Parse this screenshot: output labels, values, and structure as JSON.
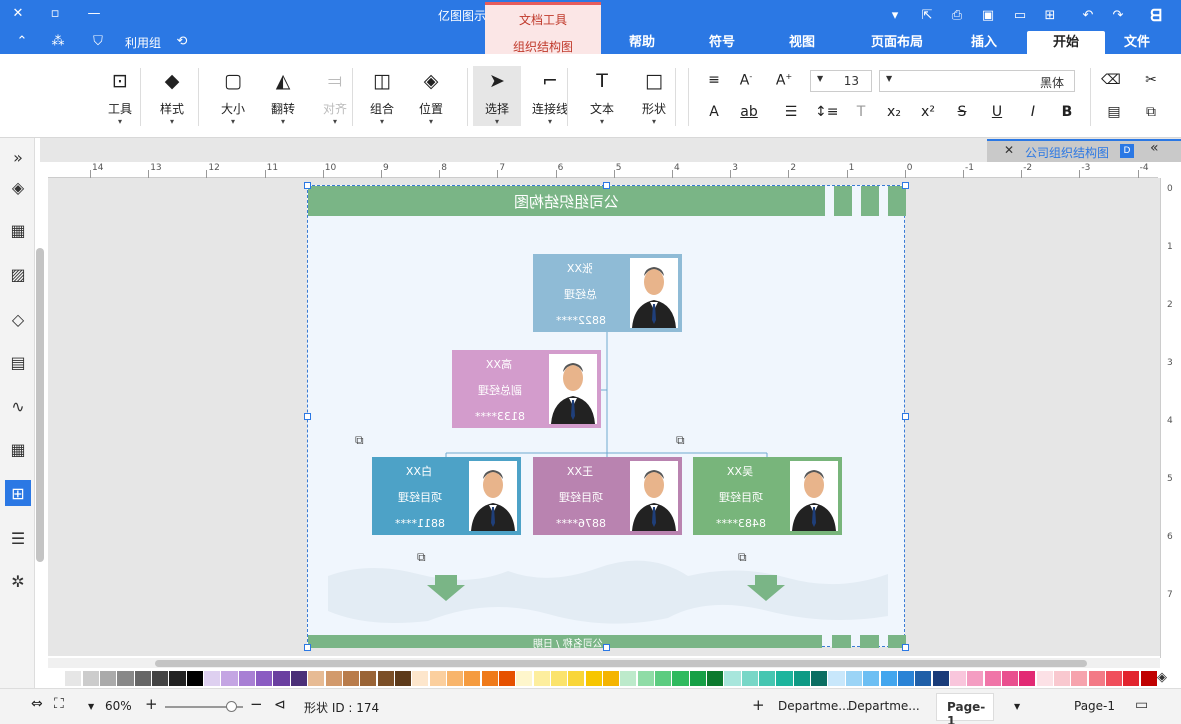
{
  "app": {
    "title": "亿图图示",
    "context_tab": {
      "group": "文档工具",
      "tab": "组织结构图"
    },
    "tabs": [
      "文件",
      "开始",
      "插入",
      "页面布局",
      "视图",
      "符号",
      "帮助"
    ],
    "active_tab": "开始",
    "quick": {
      "layout_label": "利用组"
    }
  },
  "ribbon": {
    "big_buttons": [
      {
        "label": "工具",
        "icon": "tools-icon"
      },
      {
        "label": "样式",
        "icon": "paint-bucket-icon"
      },
      {
        "label": "大小",
        "icon": "size-icon"
      },
      {
        "label": "翻转",
        "icon": "flip-icon"
      },
      {
        "label": "对齐",
        "icon": "align-icon",
        "disabled": true
      },
      {
        "label": "组合",
        "icon": "group-icon"
      },
      {
        "label": "位置",
        "icon": "position-icon"
      },
      {
        "label": "选择",
        "icon": "select-icon",
        "active": true
      },
      {
        "label": "连接线",
        "icon": "connector-icon"
      },
      {
        "label": "文本",
        "icon": "text-icon"
      },
      {
        "label": "形状",
        "icon": "shape-icon"
      }
    ],
    "font_name": "黑体",
    "font_size": "13"
  },
  "document_tab": {
    "title": "公司组织结构图"
  },
  "ruler": {
    "h_ticks": [
      "14",
      "13",
      "12",
      "11",
      "10",
      "9",
      "8",
      "7",
      "6",
      "5",
      "4",
      "3",
      "2",
      "1",
      "0",
      "-1",
      "-2",
      "-3",
      "-4"
    ],
    "v_ticks": [
      "0",
      "1",
      "2",
      "3",
      "4",
      "5",
      "6",
      "7"
    ]
  },
  "diagram": {
    "title": "公司组织结构图",
    "footer": "公司名称 / 日期",
    "nodes": [
      {
        "id": "ceo",
        "name": "张XX",
        "role": "总经理",
        "phone": "8822****",
        "color": "#8fbbd6"
      },
      {
        "id": "vp",
        "name": "高XX",
        "role": "副总经理",
        "phone": "8133****",
        "color": "#d39ccc"
      },
      {
        "id": "pm1",
        "name": "白XX",
        "role": "项目经理",
        "phone": "8811****",
        "color": "#4da2c7"
      },
      {
        "id": "pm2",
        "name": "王XX",
        "role": "项目经理",
        "phone": "8876****",
        "color": "#b983b0"
      },
      {
        "id": "pm3",
        "name": "吴XX",
        "role": "项目经理",
        "phone": "8483****",
        "color": "#78b57b"
      }
    ]
  },
  "palette": [
    "#c00000",
    "#e2242e",
    "#f04e5b",
    "#f37a86",
    "#f6a3ad",
    "#f9c8cf",
    "#fce1e6",
    "#e22a74",
    "#e94f8e",
    "#f075a8",
    "#f49dc2",
    "#f9c6dc",
    "#1a3c7a",
    "#1f5fa8",
    "#2a83d6",
    "#43a6ee",
    "#6dbff3",
    "#9bd4f6",
    "#c8e7fb",
    "#0b6e62",
    "#0e9a85",
    "#1cb59d",
    "#46c6b1",
    "#78d7c7",
    "#a8e6dc",
    "#0c7a2e",
    "#16a046",
    "#2fba5e",
    "#5ccc80",
    "#8fdca6",
    "#bdeacb",
    "#f4b400",
    "#f7c600",
    "#f9d639",
    "#fbe36c",
    "#fdee9e",
    "#fef6cc",
    "#e65100",
    "#ef7a1a",
    "#f59b3f",
    "#f8b56c",
    "#fbcf9e",
    "#fde6cc",
    "#5d3a1a",
    "#7b4f27",
    "#9a6436",
    "#b97c4b",
    "#d29a6c",
    "#e7bb94",
    "#4b2f78",
    "#6a3fa0",
    "#8a5bc2",
    "#a87fd4",
    "#c4a5e3",
    "#ded0f0",
    "#000000",
    "#222222",
    "#444444",
    "#666666",
    "#888888",
    "#aaaaaa",
    "#cccccc",
    "#e6e6e6",
    "#ffffff"
  ],
  "status": {
    "pages_label": "Page-1",
    "current_page": "Page-1",
    "tab1": "Departme...",
    "tab2": "Departme...",
    "shape_id": "形状 ID : 174",
    "zoom": "60%"
  }
}
